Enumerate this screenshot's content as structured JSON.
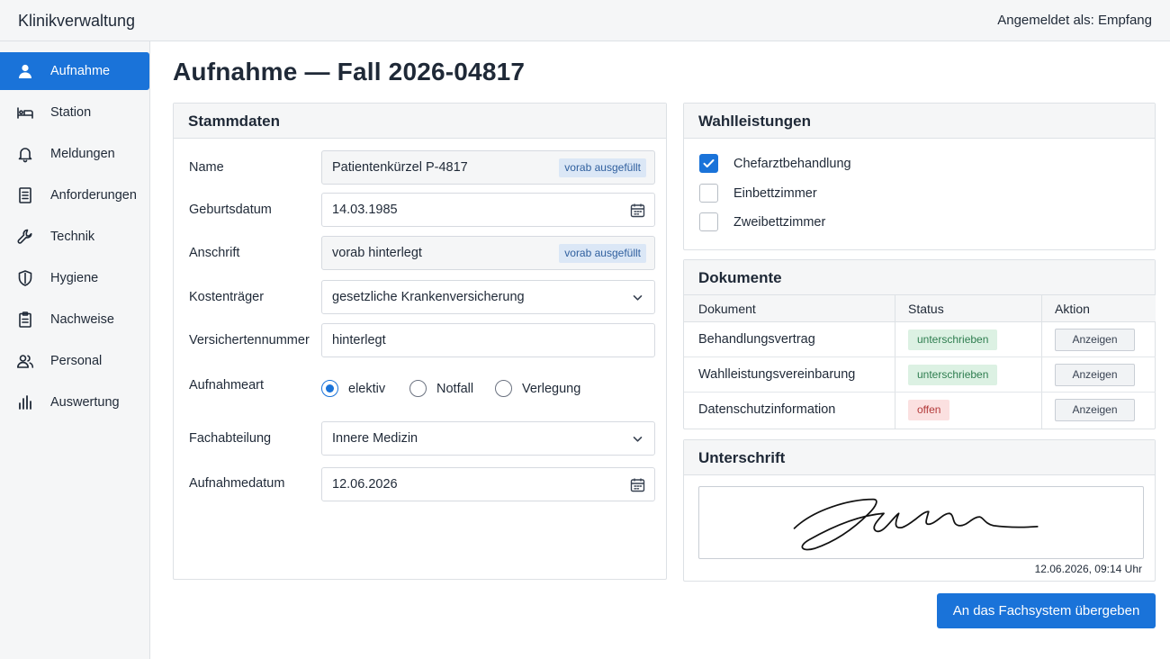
{
  "app": {
    "title": "Klinikverwaltung",
    "user_info": "Angemeldet als: Empfang"
  },
  "sidebar": {
    "items": [
      {
        "label": "Aufnahme",
        "icon": "person-icon",
        "active": true
      },
      {
        "label": "Station",
        "icon": "bed-icon"
      },
      {
        "label": "Meldungen",
        "icon": "bell-icon"
      },
      {
        "label": "Anforderungen",
        "icon": "document-icon"
      },
      {
        "label": "Technik",
        "icon": "wrench-icon"
      },
      {
        "label": "Hygiene",
        "icon": "shield-icon"
      },
      {
        "label": "Nachweise",
        "icon": "clipboard-icon"
      },
      {
        "label": "Personal",
        "icon": "people-icon"
      },
      {
        "label": "Auswertung",
        "icon": "bar-chart-icon"
      }
    ]
  },
  "page": {
    "title": "Aufnahme — Fall 2026-04817"
  },
  "stammdaten": {
    "heading": "Stammdaten",
    "prefill_badge": "vorab ausgefüllt",
    "name": {
      "label": "Name",
      "value": "Patientenkürzel P-4817"
    },
    "birthdate": {
      "label": "Geburtsdatum",
      "value": "14.03.1985"
    },
    "address": {
      "label": "Anschrift",
      "value": "vorab hinterlegt"
    },
    "insurer": {
      "label": "Kostenträger",
      "value": "gesetzliche Krankenversicherung"
    },
    "insurance_number": {
      "label": "Versichertennummer",
      "value": "hinterlegt"
    },
    "admission_type": {
      "label": "Aufnahmeart",
      "options": [
        "elektiv",
        "Notfall",
        "Verlegung"
      ],
      "selected": "elektiv"
    },
    "department": {
      "label": "Fachabteilung",
      "value": "Innere Medizin"
    },
    "admission_date": {
      "label": "Aufnahmedatum",
      "value": "12.06.2026"
    }
  },
  "wahlleistungen": {
    "heading": "Wahlleistungen",
    "options": [
      {
        "label": "Chefarztbehandlung",
        "checked": true
      },
      {
        "label": "Einbettzimmer",
        "checked": false
      },
      {
        "label": "Zweibettzimmer",
        "checked": false
      }
    ]
  },
  "dokumente": {
    "heading": "Dokumente",
    "columns": [
      "Dokument",
      "Status",
      "Aktion"
    ],
    "rows": [
      {
        "name": "Behandlungsvertrag",
        "status": "unterschrieben",
        "action": "Anzeigen"
      },
      {
        "name": "Wahlleistungsvereinbarung",
        "status": "unterschrieben",
        "action": "Anzeigen"
      },
      {
        "name": "Datenschutzinformation",
        "status": "offen",
        "action": "Anzeigen"
      }
    ]
  },
  "unterschrift": {
    "heading": "Unterschrift",
    "timestamp": "12.06.2026, 09:14 Uhr"
  },
  "submit_label": "An das Fachsystem übergeben",
  "colors": {
    "accent": "#1a73d9",
    "signed": "#2e7d4f",
    "open": "#b33a3a",
    "badge": "#dbe7f6"
  }
}
